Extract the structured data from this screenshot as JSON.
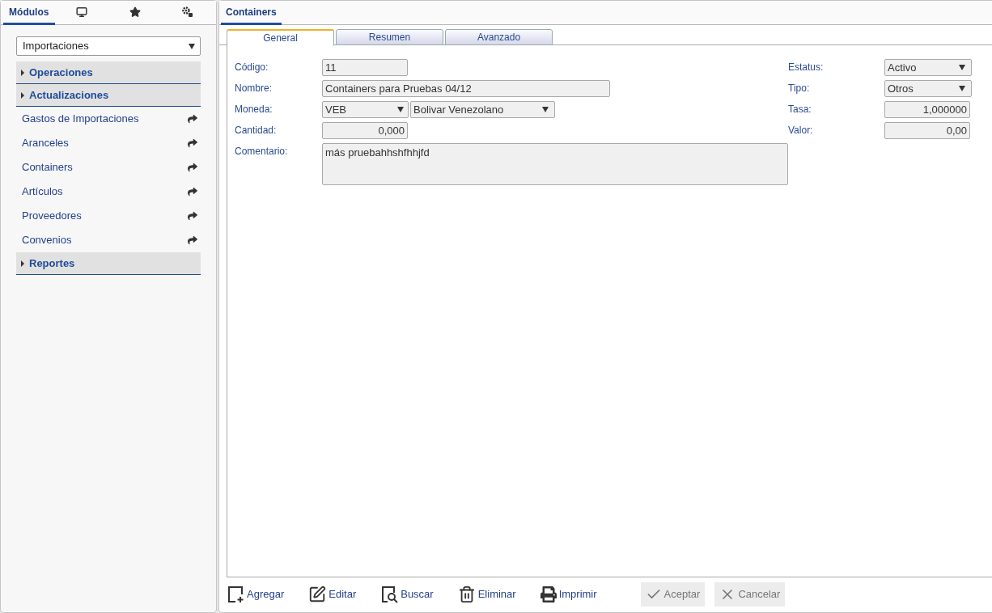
{
  "sidebar": {
    "tabs": [
      {
        "kind": "text",
        "label": "Módulos",
        "selected": true
      },
      {
        "kind": "monitor",
        "selected": false
      },
      {
        "kind": "star",
        "selected": false
      },
      {
        "kind": "gears",
        "selected": false
      }
    ],
    "module_select": {
      "value": "Importaciones"
    },
    "sections": [
      {
        "label": "Operaciones"
      },
      {
        "label": "Actualizaciones",
        "children": [
          {
            "label": "Gastos de Importaciones"
          },
          {
            "label": "Aranceles"
          },
          {
            "label": "Containers"
          },
          {
            "label": "Artículos"
          },
          {
            "label": "Proveedores"
          },
          {
            "label": "Convenios"
          }
        ]
      },
      {
        "label": "Reportes"
      }
    ]
  },
  "main": {
    "tabs": [
      {
        "label": "Containers",
        "selected": true
      }
    ],
    "form_tabs": [
      {
        "label": "General",
        "selected": true
      },
      {
        "label": "Resumen",
        "selected": false
      },
      {
        "label": "Avanzado",
        "selected": false
      }
    ],
    "fields_left": [
      {
        "label": "Código:",
        "kind": "short",
        "value": "11"
      },
      {
        "label": "Nombre:",
        "kind": "long",
        "value": "Containers para Pruebas 04/12"
      },
      {
        "label": "Moneda:",
        "kind": "currency",
        "value": "VEB",
        "value_2": "Bolivar Venezolano"
      },
      {
        "label": "Cantidad:",
        "kind": "number",
        "value": "0,000"
      },
      {
        "label": "Comentario:",
        "kind": "textarea",
        "value": "más pruebahhshfhhjfd"
      }
    ],
    "fields_right": [
      {
        "label": "Estatus:",
        "kind": "select",
        "value": "Activo"
      },
      {
        "label": "Tipo:",
        "kind": "select",
        "value": "Otros"
      },
      {
        "label": "Tasa:",
        "kind": "number",
        "value": "1,000000"
      },
      {
        "label": "Valor:",
        "kind": "number",
        "value": "0,00"
      }
    ],
    "toolbar": [
      {
        "kind": "add",
        "label": "Agregar",
        "disabled": false
      },
      {
        "kind": "edit",
        "label": "Editar",
        "disabled": false
      },
      {
        "kind": "search",
        "label": "Buscar",
        "disabled": false
      },
      {
        "kind": "delete",
        "label": "Eliminar",
        "disabled": false
      },
      {
        "kind": "print",
        "label": "Imprimir",
        "disabled": false
      },
      {
        "kind": "accept",
        "label": "Aceptar",
        "disabled": true
      },
      {
        "kind": "cancel",
        "label": "Cancelar",
        "disabled": true
      }
    ]
  }
}
